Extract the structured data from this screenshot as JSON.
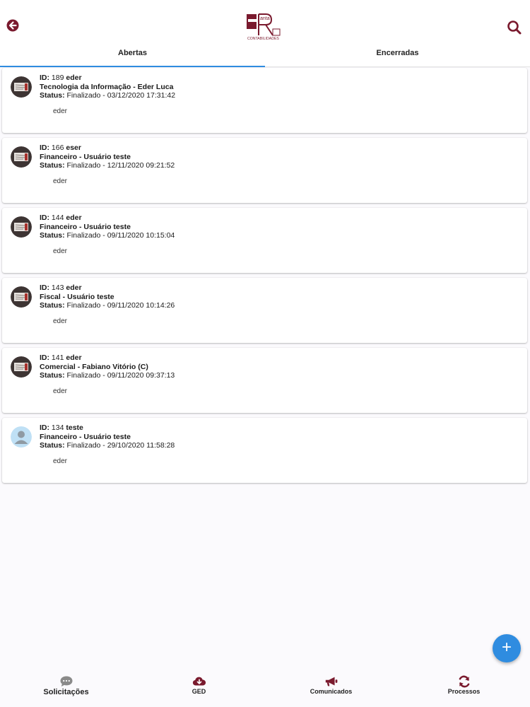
{
  "header": {
    "back_icon": "arrow-left-circle-icon",
    "search_icon": "search-icon",
    "logo_word": "anta",
    "logo_sub": "CONTABILIDADES",
    "brand_color": "#7a1a2e"
  },
  "tabs": [
    {
      "label": "Abertas",
      "active": true
    },
    {
      "label": "Encerradas",
      "active": false
    }
  ],
  "tickets": [
    {
      "id_label": "ID:",
      "id": "189",
      "user": "eder",
      "title": "Tecnologia da Informação - Eder Luca",
      "status_label": "Status:",
      "status": "Finalizado - 03/12/2020 17:31:42",
      "note": "eder",
      "avatar": "photo"
    },
    {
      "id_label": "ID:",
      "id": "166",
      "user": "eser",
      "title": "Financeiro - Usuário teste",
      "status_label": "Status:",
      "status": "Finalizado - 12/11/2020 09:21:52",
      "note": "eder",
      "avatar": "photo"
    },
    {
      "id_label": "ID:",
      "id": "144",
      "user": "eder",
      "title": "Financeiro - Usuário teste",
      "status_label": "Status:",
      "status": "Finalizado - 09/11/2020 10:15:04",
      "note": "eder",
      "avatar": "photo"
    },
    {
      "id_label": "ID:",
      "id": "143",
      "user": "eder",
      "title": "Fiscal - Usuário teste",
      "status_label": "Status:",
      "status": "Finalizado - 09/11/2020 10:14:26",
      "note": "eder",
      "avatar": "photo"
    },
    {
      "id_label": "ID:",
      "id": "141",
      "user": "eder",
      "title": "Comercial - Fabiano Vitório (C)",
      "status_label": "Status:",
      "status": "Finalizado - 09/11/2020 09:37:13",
      "note": "eder",
      "avatar": "photo"
    },
    {
      "id_label": "ID:",
      "id": "134",
      "user": "teste",
      "title": "Financeiro - Usuário teste",
      "status_label": "Status:",
      "status": "Finalizado - 29/10/2020 11:58:28",
      "note": "eder",
      "avatar": "placeholder"
    }
  ],
  "fab": {
    "label": "+",
    "icon": "plus-icon",
    "color": "#2f8ce0"
  },
  "bottom_nav": [
    {
      "label": "Solicitações",
      "icon": "chat-bubble-icon",
      "color": "#8a8a8a"
    },
    {
      "label": "GED",
      "icon": "cloud-download-icon",
      "color": "#7a1a2e"
    },
    {
      "label": "Comunicados",
      "icon": "megaphone-icon",
      "color": "#7a1a2e"
    },
    {
      "label": "Processos",
      "icon": "refresh-icon",
      "color": "#7a1a2e"
    }
  ]
}
